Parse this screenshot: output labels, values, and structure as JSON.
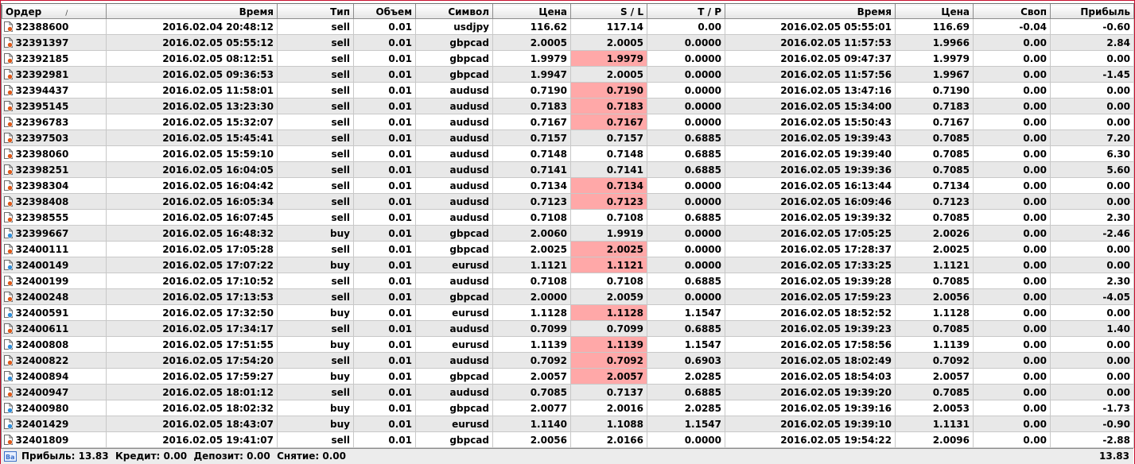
{
  "columns": [
    "Ордер",
    "Время",
    "Тип",
    "Объем",
    "Символ",
    "Цена",
    "S / L",
    "T / P",
    "Время",
    "Цена",
    "Своп",
    "Прибыль"
  ],
  "sort_indicator": "/",
  "rows": [
    {
      "order": "32388600",
      "open_time": "2016.02.04 20:48:12",
      "type": "sell",
      "volume": "0.01",
      "symbol": "usdjpy",
      "open_price": "116.62",
      "sl": "117.14",
      "tp": "0.00",
      "close_time": "2016.02.05 05:55:01",
      "close_price": "116.69",
      "swap": "-0.04",
      "profit": "-0.60",
      "sl_hit": false
    },
    {
      "order": "32391397",
      "open_time": "2016.02.05 05:55:12",
      "type": "sell",
      "volume": "0.01",
      "symbol": "gbpcad",
      "open_price": "2.0005",
      "sl": "2.0005",
      "tp": "0.0000",
      "close_time": "2016.02.05 11:57:53",
      "close_price": "1.9966",
      "swap": "0.00",
      "profit": "2.84",
      "sl_hit": false
    },
    {
      "order": "32392185",
      "open_time": "2016.02.05 08:12:51",
      "type": "sell",
      "volume": "0.01",
      "symbol": "gbpcad",
      "open_price": "1.9979",
      "sl": "1.9979",
      "tp": "0.0000",
      "close_time": "2016.02.05 09:47:37",
      "close_price": "1.9979",
      "swap": "0.00",
      "profit": "0.00",
      "sl_hit": true
    },
    {
      "order": "32392981",
      "open_time": "2016.02.05 09:36:53",
      "type": "sell",
      "volume": "0.01",
      "symbol": "gbpcad",
      "open_price": "1.9947",
      "sl": "2.0005",
      "tp": "0.0000",
      "close_time": "2016.02.05 11:57:56",
      "close_price": "1.9967",
      "swap": "0.00",
      "profit": "-1.45",
      "sl_hit": false
    },
    {
      "order": "32394437",
      "open_time": "2016.02.05 11:58:01",
      "type": "sell",
      "volume": "0.01",
      "symbol": "audusd",
      "open_price": "0.7190",
      "sl": "0.7190",
      "tp": "0.0000",
      "close_time": "2016.02.05 13:47:16",
      "close_price": "0.7190",
      "swap": "0.00",
      "profit": "0.00",
      "sl_hit": true
    },
    {
      "order": "32395145",
      "open_time": "2016.02.05 13:23:30",
      "type": "sell",
      "volume": "0.01",
      "symbol": "audusd",
      "open_price": "0.7183",
      "sl": "0.7183",
      "tp": "0.0000",
      "close_time": "2016.02.05 15:34:00",
      "close_price": "0.7183",
      "swap": "0.00",
      "profit": "0.00",
      "sl_hit": true
    },
    {
      "order": "32396783",
      "open_time": "2016.02.05 15:32:07",
      "type": "sell",
      "volume": "0.01",
      "symbol": "audusd",
      "open_price": "0.7167",
      "sl": "0.7167",
      "tp": "0.0000",
      "close_time": "2016.02.05 15:50:43",
      "close_price": "0.7167",
      "swap": "0.00",
      "profit": "0.00",
      "sl_hit": true
    },
    {
      "order": "32397503",
      "open_time": "2016.02.05 15:45:41",
      "type": "sell",
      "volume": "0.01",
      "symbol": "audusd",
      "open_price": "0.7157",
      "sl": "0.7157",
      "tp": "0.6885",
      "close_time": "2016.02.05 19:39:43",
      "close_price": "0.7085",
      "swap": "0.00",
      "profit": "7.20",
      "sl_hit": false
    },
    {
      "order": "32398060",
      "open_time": "2016.02.05 15:59:10",
      "type": "sell",
      "volume": "0.01",
      "symbol": "audusd",
      "open_price": "0.7148",
      "sl": "0.7148",
      "tp": "0.6885",
      "close_time": "2016.02.05 19:39:40",
      "close_price": "0.7085",
      "swap": "0.00",
      "profit": "6.30",
      "sl_hit": false
    },
    {
      "order": "32398251",
      "open_time": "2016.02.05 16:04:05",
      "type": "sell",
      "volume": "0.01",
      "symbol": "audusd",
      "open_price": "0.7141",
      "sl": "0.7141",
      "tp": "0.6885",
      "close_time": "2016.02.05 19:39:36",
      "close_price": "0.7085",
      "swap": "0.00",
      "profit": "5.60",
      "sl_hit": false
    },
    {
      "order": "32398304",
      "open_time": "2016.02.05 16:04:42",
      "type": "sell",
      "volume": "0.01",
      "symbol": "audusd",
      "open_price": "0.7134",
      "sl": "0.7134",
      "tp": "0.0000",
      "close_time": "2016.02.05 16:13:44",
      "close_price": "0.7134",
      "swap": "0.00",
      "profit": "0.00",
      "sl_hit": true
    },
    {
      "order": "32398408",
      "open_time": "2016.02.05 16:05:34",
      "type": "sell",
      "volume": "0.01",
      "symbol": "audusd",
      "open_price": "0.7123",
      "sl": "0.7123",
      "tp": "0.0000",
      "close_time": "2016.02.05 16:09:46",
      "close_price": "0.7123",
      "swap": "0.00",
      "profit": "0.00",
      "sl_hit": true
    },
    {
      "order": "32398555",
      "open_time": "2016.02.05 16:07:45",
      "type": "sell",
      "volume": "0.01",
      "symbol": "audusd",
      "open_price": "0.7108",
      "sl": "0.7108",
      "tp": "0.6885",
      "close_time": "2016.02.05 19:39:32",
      "close_price": "0.7085",
      "swap": "0.00",
      "profit": "2.30",
      "sl_hit": false
    },
    {
      "order": "32399667",
      "open_time": "2016.02.05 16:48:32",
      "type": "buy",
      "volume": "0.01",
      "symbol": "gbpcad",
      "open_price": "2.0060",
      "sl": "1.9919",
      "tp": "0.0000",
      "close_time": "2016.02.05 17:05:25",
      "close_price": "2.0026",
      "swap": "0.00",
      "profit": "-2.46",
      "sl_hit": false
    },
    {
      "order": "32400111",
      "open_time": "2016.02.05 17:05:28",
      "type": "sell",
      "volume": "0.01",
      "symbol": "gbpcad",
      "open_price": "2.0025",
      "sl": "2.0025",
      "tp": "0.0000",
      "close_time": "2016.02.05 17:28:37",
      "close_price": "2.0025",
      "swap": "0.00",
      "profit": "0.00",
      "sl_hit": true
    },
    {
      "order": "32400149",
      "open_time": "2016.02.05 17:07:22",
      "type": "buy",
      "volume": "0.01",
      "symbol": "eurusd",
      "open_price": "1.1121",
      "sl": "1.1121",
      "tp": "0.0000",
      "close_time": "2016.02.05 17:33:25",
      "close_price": "1.1121",
      "swap": "0.00",
      "profit": "0.00",
      "sl_hit": true
    },
    {
      "order": "32400199",
      "open_time": "2016.02.05 17:10:52",
      "type": "sell",
      "volume": "0.01",
      "symbol": "audusd",
      "open_price": "0.7108",
      "sl": "0.7108",
      "tp": "0.6885",
      "close_time": "2016.02.05 19:39:28",
      "close_price": "0.7085",
      "swap": "0.00",
      "profit": "2.30",
      "sl_hit": false
    },
    {
      "order": "32400248",
      "open_time": "2016.02.05 17:13:53",
      "type": "sell",
      "volume": "0.01",
      "symbol": "gbpcad",
      "open_price": "2.0000",
      "sl": "2.0059",
      "tp": "0.0000",
      "close_time": "2016.02.05 17:59:23",
      "close_price": "2.0056",
      "swap": "0.00",
      "profit": "-4.05",
      "sl_hit": false
    },
    {
      "order": "32400591",
      "open_time": "2016.02.05 17:32:50",
      "type": "buy",
      "volume": "0.01",
      "symbol": "eurusd",
      "open_price": "1.1128",
      "sl": "1.1128",
      "tp": "1.1547",
      "close_time": "2016.02.05 18:52:52",
      "close_price": "1.1128",
      "swap": "0.00",
      "profit": "0.00",
      "sl_hit": true
    },
    {
      "order": "32400611",
      "open_time": "2016.02.05 17:34:17",
      "type": "sell",
      "volume": "0.01",
      "symbol": "audusd",
      "open_price": "0.7099",
      "sl": "0.7099",
      "tp": "0.6885",
      "close_time": "2016.02.05 19:39:23",
      "close_price": "0.7085",
      "swap": "0.00",
      "profit": "1.40",
      "sl_hit": false
    },
    {
      "order": "32400808",
      "open_time": "2016.02.05 17:51:55",
      "type": "buy",
      "volume": "0.01",
      "symbol": "eurusd",
      "open_price": "1.1139",
      "sl": "1.1139",
      "tp": "1.1547",
      "close_time": "2016.02.05 17:58:56",
      "close_price": "1.1139",
      "swap": "0.00",
      "profit": "0.00",
      "sl_hit": true
    },
    {
      "order": "32400822",
      "open_time": "2016.02.05 17:54:20",
      "type": "sell",
      "volume": "0.01",
      "symbol": "audusd",
      "open_price": "0.7092",
      "sl": "0.7092",
      "tp": "0.6903",
      "close_time": "2016.02.05 18:02:49",
      "close_price": "0.7092",
      "swap": "0.00",
      "profit": "0.00",
      "sl_hit": true
    },
    {
      "order": "32400894",
      "open_time": "2016.02.05 17:59:27",
      "type": "buy",
      "volume": "0.01",
      "symbol": "gbpcad",
      "open_price": "2.0057",
      "sl": "2.0057",
      "tp": "2.0285",
      "close_time": "2016.02.05 18:54:03",
      "close_price": "2.0057",
      "swap": "0.00",
      "profit": "0.00",
      "sl_hit": true
    },
    {
      "order": "32400947",
      "open_time": "2016.02.05 18:01:12",
      "type": "sell",
      "volume": "0.01",
      "symbol": "audusd",
      "open_price": "0.7085",
      "sl": "0.7137",
      "tp": "0.6885",
      "close_time": "2016.02.05 19:39:20",
      "close_price": "0.7085",
      "swap": "0.00",
      "profit": "0.00",
      "sl_hit": false
    },
    {
      "order": "32400980",
      "open_time": "2016.02.05 18:02:32",
      "type": "buy",
      "volume": "0.01",
      "symbol": "gbpcad",
      "open_price": "2.0077",
      "sl": "2.0016",
      "tp": "2.0285",
      "close_time": "2016.02.05 19:39:16",
      "close_price": "2.0053",
      "swap": "0.00",
      "profit": "-1.73",
      "sl_hit": false
    },
    {
      "order": "32401429",
      "open_time": "2016.02.05 18:43:07",
      "type": "buy",
      "volume": "0.01",
      "symbol": "eurusd",
      "open_price": "1.1140",
      "sl": "1.1088",
      "tp": "1.1547",
      "close_time": "2016.02.05 19:39:10",
      "close_price": "1.1131",
      "swap": "0.00",
      "profit": "-0.90",
      "sl_hit": false
    },
    {
      "order": "32401809",
      "open_time": "2016.02.05 19:41:07",
      "type": "sell",
      "volume": "0.01",
      "symbol": "gbpcad",
      "open_price": "2.0056",
      "sl": "2.0166",
      "tp": "0.0000",
      "close_time": "2016.02.05 19:54:22",
      "close_price": "2.0096",
      "swap": "0.00",
      "profit": "-2.88",
      "sl_hit": false
    }
  ],
  "footer": {
    "summary": "Прибыль: 13.83  Кредит: 0.00  Депозит: 0.00  Снятие: 0.00",
    "total": "13.83",
    "icon": "balance-icon"
  },
  "colors": {
    "sl_highlight": "#ffa8a8",
    "row_alt": "#e8e8e8",
    "sell_dot": "#e05a1a",
    "buy_dot": "#2f8fdc",
    "window_border": "#c8102e"
  }
}
